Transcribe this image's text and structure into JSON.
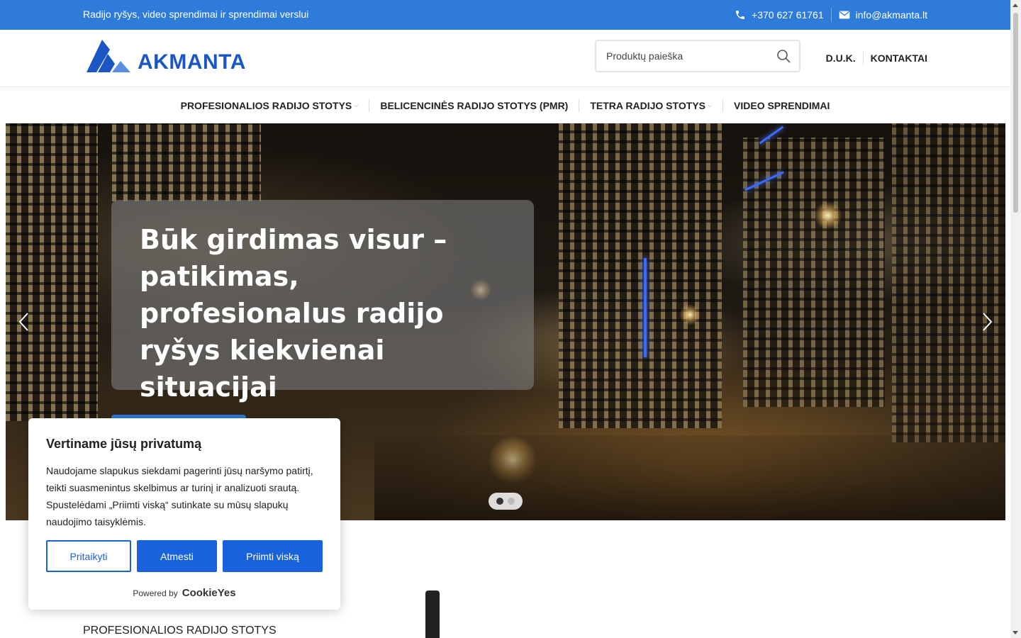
{
  "topbar": {
    "tagline": "Radijo ryšys, video sprendimai ir sprendimai verslui",
    "phone": "+370 627 61761",
    "email": "info@akmanta.lt",
    "background_color": "#2f7bd9"
  },
  "header": {
    "logo_text": "AKMANTA",
    "search_placeholder": "Produktų paieška",
    "links": [
      "D.U.K.",
      "KONTAKTAI"
    ]
  },
  "nav": {
    "items": [
      {
        "label": "PROFESIONALIOS RADIJO STOTYS",
        "has_dropdown": true
      },
      {
        "label": "BELICENCINĖS RADIJO STOTYS (PMR)",
        "has_dropdown": false
      },
      {
        "label": "TETRA RADIJO STOTYS",
        "has_dropdown": true
      },
      {
        "label": "VIDEO SPRENDIMAI",
        "has_dropdown": false
      }
    ]
  },
  "hero": {
    "title": "Būk girdimas visur – patikimas, profesionalus radijo ryšys kiekvienai situacijai",
    "slides_count": 2,
    "active_slide": 1
  },
  "section": {
    "label": "PROFESIONALIOS RADIJO STOTYS"
  },
  "cookie": {
    "title": "Vertiname jūsų privatumą",
    "text": "Naudojame slapukus siekdami pagerinti jūsų naršymo patirtį, teikti suasmenintus skelbimus ar turinį ir analizuoti srautą. Spustelėdami „Priimti viską“ sutinkate su mūsų slapukų naudojimo taisyklėmis.",
    "customize_label": "Pritaikyti",
    "reject_label": "Atmesti",
    "accept_label": "Priimti viską",
    "powered_by": "Powered by",
    "brand": "CookieYes",
    "accent_color": "#1863dc"
  }
}
